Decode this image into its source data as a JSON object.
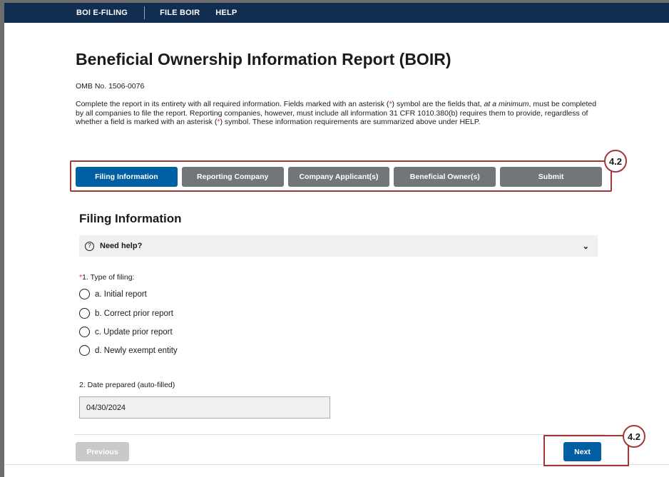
{
  "nav": {
    "items": [
      "BOI E-FILING",
      "FILE BOIR",
      "HELP"
    ]
  },
  "page": {
    "title": "Beneficial Ownership Information Report (BOIR)",
    "omb": "OMB No. 1506-0076",
    "intro": {
      "p1": "Complete the report in its entirety with all required information. Fields marked with an asterisk (",
      "star": "*",
      "p2": ") symbol are the fields that, ",
      "em": "at a minimum",
      "p3": ", must be completed by all companies to file the report. Reporting companies, however, must include all information 31 CFR 1010.380(b) requires them to provide, regardless of whether a field is marked with an asterisk (",
      "p4": ") symbol. These information requirements are summarized above under HELP."
    }
  },
  "steps": {
    "items": [
      "Filing Information",
      "Reporting Company",
      "Company Applicant(s)",
      "Beneficial Owner(s)",
      "Submit"
    ],
    "active": "Filing Information"
  },
  "callouts": {
    "top": "4.2",
    "bottom": "4.2"
  },
  "section": {
    "title": "Filing Information",
    "help": {
      "label": "Need help?",
      "icon": "question-circle-icon",
      "chevron": "chevron-down-icon"
    }
  },
  "filing_type": {
    "required_mark": "*",
    "label": "1. Type of filing:",
    "options": [
      "a. Initial report",
      "b. Correct prior report",
      "c. Update prior report",
      "d. Newly exempt entity"
    ]
  },
  "date_prepared": {
    "label": "2. Date prepared (auto-filled)",
    "value": "04/30/2024"
  },
  "buttons": {
    "previous": "Previous",
    "next": "Next"
  },
  "colors": {
    "nav_bg": "#112e51",
    "primary": "#005ea2",
    "step_inactive": "#71767a",
    "callout_border": "#a23737",
    "required": "#d83933"
  }
}
